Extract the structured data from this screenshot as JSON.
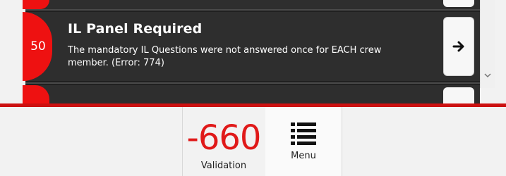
{
  "validation_list": {
    "items": [
      {
        "score": "50",
        "title": "IL Panel Required",
        "description": "The mandatory IL Questions were not answered once for EACH crew member. (Error: 774)",
        "action_icon": "arrow-right-icon"
      }
    ]
  },
  "footer": {
    "validation": {
      "value": "-660",
      "label": "Validation"
    },
    "menu": {
      "label": "Menu",
      "icon": "hamburger-menu-icon"
    }
  },
  "colors": {
    "accent_red": "#ee1111",
    "panel_bg": "#2e2e2e",
    "score_text": "#e01919"
  }
}
